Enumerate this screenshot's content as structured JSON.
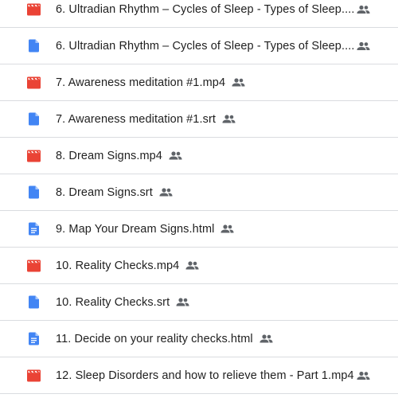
{
  "files": [
    {
      "name": "6. Ultradian Rhythm – Cycles of Sleep - Types of Sleep....",
      "type": "video",
      "icon": "video-icon",
      "shared": true,
      "truncated": true
    },
    {
      "name": "6. Ultradian Rhythm – Cycles of Sleep - Types of Sleep....",
      "type": "file",
      "icon": "file-icon",
      "shared": true,
      "truncated": true
    },
    {
      "name": "7. Awareness meditation #1.mp4",
      "type": "video",
      "icon": "video-icon",
      "shared": true,
      "truncated": false
    },
    {
      "name": "7. Awareness meditation #1.srt",
      "type": "file",
      "icon": "file-icon",
      "shared": true,
      "truncated": false
    },
    {
      "name": "8. Dream Signs.mp4",
      "type": "video",
      "icon": "video-icon",
      "shared": true,
      "truncated": false
    },
    {
      "name": "8. Dream Signs.srt",
      "type": "file",
      "icon": "file-icon",
      "shared": true,
      "truncated": false
    },
    {
      "name": "9. Map Your Dream Signs.html",
      "type": "doc",
      "icon": "document-icon",
      "shared": true,
      "truncated": false
    },
    {
      "name": "10. Reality Checks.mp4",
      "type": "video",
      "icon": "video-icon",
      "shared": true,
      "truncated": false
    },
    {
      "name": "10. Reality Checks.srt",
      "type": "file",
      "icon": "file-icon",
      "shared": true,
      "truncated": false
    },
    {
      "name": "11. Decide on your reality checks.html",
      "type": "doc",
      "icon": "document-icon",
      "shared": true,
      "truncated": false
    },
    {
      "name": "12. Sleep Disorders and how to relieve them - Part 1.mp4",
      "type": "video",
      "icon": "video-icon",
      "shared": true,
      "truncated": false
    }
  ],
  "colors": {
    "video": "#ea4335",
    "file": "#4285f4",
    "doc": "#4285f4",
    "shared": "#5f6368",
    "divider": "#dadce0",
    "text": "#1f1f1f"
  }
}
